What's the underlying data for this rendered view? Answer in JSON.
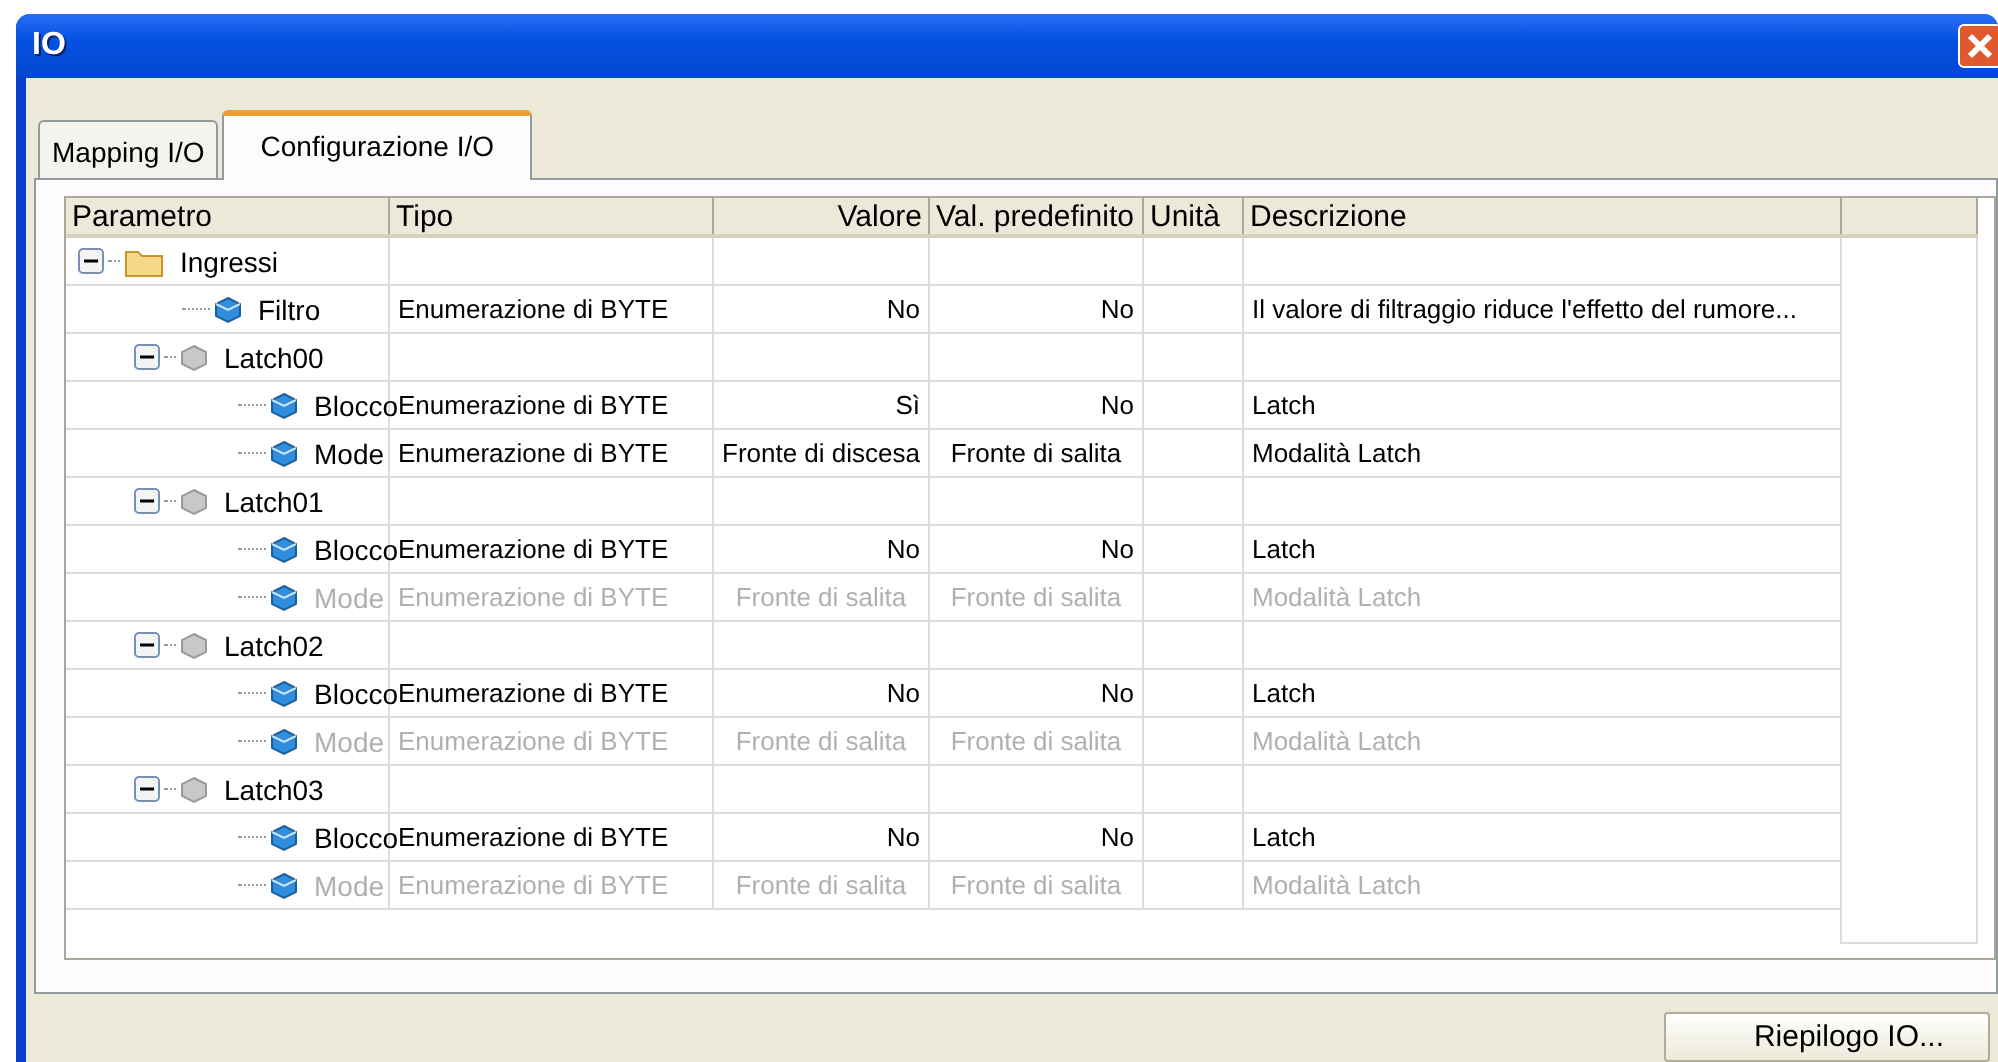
{
  "window": {
    "title": "IO"
  },
  "tabs": [
    {
      "label": "Mapping I/O",
      "selected": false
    },
    {
      "label": "Configurazione I/O",
      "selected": true
    }
  ],
  "table": {
    "columns": [
      {
        "label": "Parametro"
      },
      {
        "label": "Tipo"
      },
      {
        "label": "Valore"
      },
      {
        "label": "Val. predefinito"
      },
      {
        "label": "Unità"
      },
      {
        "label": "Descrizione"
      }
    ],
    "tree": [
      {
        "name": "Ingressi",
        "kind": "folder",
        "expanded": true,
        "children": [
          {
            "name": "Filtro",
            "kind": "param",
            "disabled": false,
            "type": "Enumerazione di BYTE",
            "value": "No",
            "default": "No",
            "description": "Il valore di filtraggio riduce l'effetto del rumore..."
          },
          {
            "name": "Latch00",
            "kind": "group",
            "expanded": true,
            "children": [
              {
                "name": "Blocco",
                "kind": "param",
                "disabled": false,
                "type": "Enumerazione di BYTE",
                "value": "Sì",
                "default": "No",
                "description": "Latch"
              },
              {
                "name": "Mode",
                "kind": "param",
                "disabled": false,
                "type": "Enumerazione di BYTE",
                "value": "Fronte di discesa",
                "default": "Fronte di salita",
                "description": "Modalità Latch"
              }
            ]
          },
          {
            "name": "Latch01",
            "kind": "group",
            "expanded": true,
            "children": [
              {
                "name": "Blocco",
                "kind": "param",
                "disabled": false,
                "type": "Enumerazione di BYTE",
                "value": "No",
                "default": "No",
                "description": "Latch"
              },
              {
                "name": "Mode",
                "kind": "param",
                "disabled": true,
                "type": "Enumerazione di BYTE",
                "value": "Fronte di salita",
                "default": "Fronte di salita",
                "description": "Modalità Latch"
              }
            ]
          },
          {
            "name": "Latch02",
            "kind": "group",
            "expanded": true,
            "children": [
              {
                "name": "Blocco",
                "kind": "param",
                "disabled": false,
                "type": "Enumerazione di BYTE",
                "value": "No",
                "default": "No",
                "description": "Latch"
              },
              {
                "name": "Mode",
                "kind": "param",
                "disabled": true,
                "type": "Enumerazione di BYTE",
                "value": "Fronte di salita",
                "default": "Fronte di salita",
                "description": "Modalità Latch"
              }
            ]
          },
          {
            "name": "Latch03",
            "kind": "group",
            "expanded": true,
            "children": [
              {
                "name": "Blocco",
                "kind": "param",
                "disabled": false,
                "type": "Enumerazione di BYTE",
                "value": "No",
                "default": "No",
                "description": "Latch"
              },
              {
                "name": "Mode",
                "kind": "param",
                "disabled": true,
                "type": "Enumerazione di BYTE",
                "value": "Fronte di salita",
                "default": "Fronte di salita",
                "description": "Modalità Latch"
              }
            ]
          }
        ]
      }
    ]
  },
  "buttons": [
    {
      "label": "Riepilogo IO..."
    }
  ]
}
